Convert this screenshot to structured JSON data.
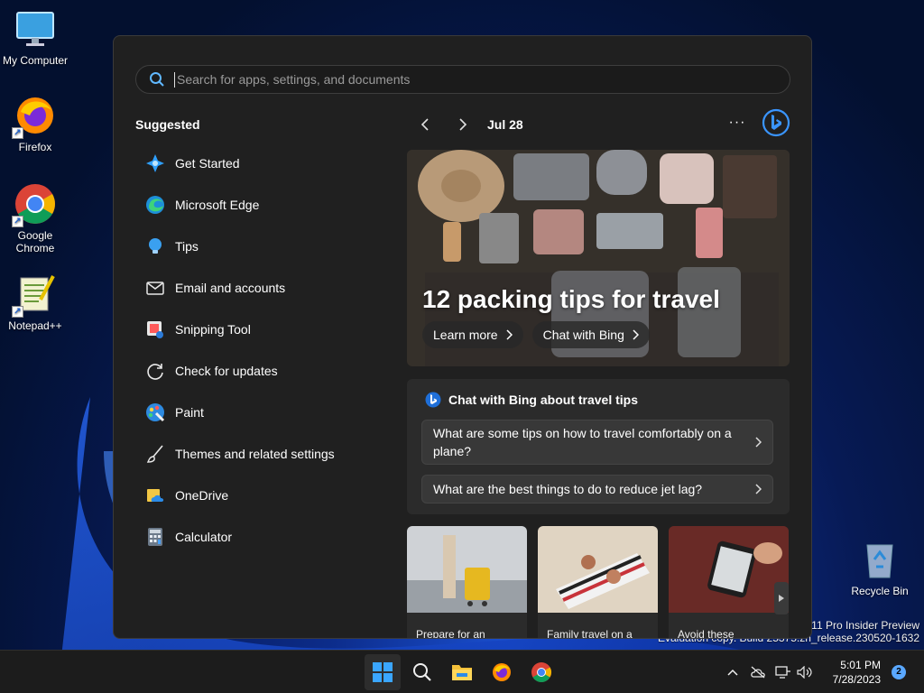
{
  "desktop": {
    "icons": [
      {
        "label": "My Computer"
      },
      {
        "label": "Firefox"
      },
      {
        "label": "Google Chrome"
      },
      {
        "label": "Notepad++"
      },
      {
        "label": "Recycle Bin"
      }
    ],
    "watermark": {
      "line1": "s 11 Pro Insider Preview",
      "line2": "Evaluation copy. Build 25375.zn_release.230520-1632"
    }
  },
  "start": {
    "search": {
      "placeholder": "Search for apps, settings, and documents",
      "value": ""
    },
    "suggested_title": "Suggested",
    "suggested": [
      {
        "label": "Get Started",
        "icon": "get-started-icon"
      },
      {
        "label": "Microsoft Edge",
        "icon": "edge-icon"
      },
      {
        "label": "Tips",
        "icon": "tips-icon"
      },
      {
        "label": "Email and accounts",
        "icon": "mail-icon"
      },
      {
        "label": "Snipping Tool",
        "icon": "snipping-tool-icon"
      },
      {
        "label": "Check for updates",
        "icon": "refresh-icon"
      },
      {
        "label": "Paint",
        "icon": "paint-icon"
      },
      {
        "label": "Themes and related settings",
        "icon": "brush-icon"
      },
      {
        "label": "OneDrive",
        "icon": "onedrive-icon"
      },
      {
        "label": "Calculator",
        "icon": "calculator-icon"
      }
    ],
    "date": "Jul 28",
    "more": "···",
    "hero": {
      "title": "12 packing tips for travel",
      "learn_more": "Learn more",
      "chat_with_bing": "Chat with Bing"
    },
    "chat": {
      "heading": "Chat with Bing about travel tips",
      "q1": "What are some tips on how to travel comfortably on a plane?",
      "q2": "What are the best things to do to reduce jet lag?"
    },
    "thumbs": [
      {
        "caption": "Prepare for an"
      },
      {
        "caption": "Family travel on a"
      },
      {
        "caption": "Avoid these"
      }
    ]
  },
  "taskbar": {
    "time": "5:01 PM",
    "date": "7/28/2023",
    "notifications": "2"
  },
  "colors": {
    "accent": "#0078d4",
    "panel": "#202020",
    "card": "#2b2b2b",
    "taskbar": "#1c1c1c"
  }
}
